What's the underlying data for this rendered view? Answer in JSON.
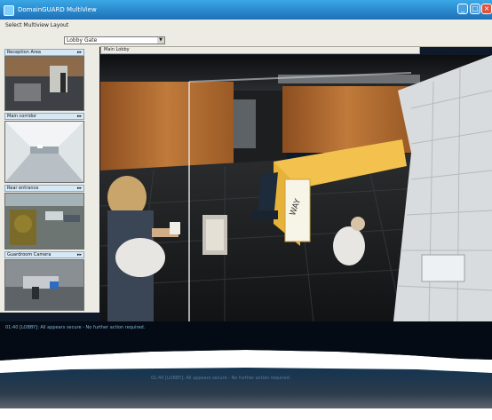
{
  "window": {
    "title": "DomainGUARD MultiView",
    "buttons": {
      "minimize": "_",
      "maximize": "□",
      "close": "×"
    }
  },
  "toolbar": {
    "label": "Select Multiview Layout",
    "select_value": "Lobby Gate"
  },
  "cameras": [
    {
      "label": "Reception Area",
      "control": "▸▸"
    },
    {
      "label": "Main corridor",
      "control": "▸▸"
    },
    {
      "label": "Rear entrance",
      "control": "▸▸"
    },
    {
      "label": "Guardroom Camera",
      "control": "▸▸"
    }
  ],
  "main": {
    "label": "Main Lobby",
    "sign_text": "WAY"
  },
  "status": {
    "text": "01:40 [LOBBY]: All appears secure - No further action required."
  },
  "colors": {
    "title_blue": "#2a8ad0",
    "frame_dark": "#0e1a2a",
    "panel_grey": "#ecebe4",
    "wood": "#b0672c",
    "desk_yellow": "#f2c14e"
  }
}
